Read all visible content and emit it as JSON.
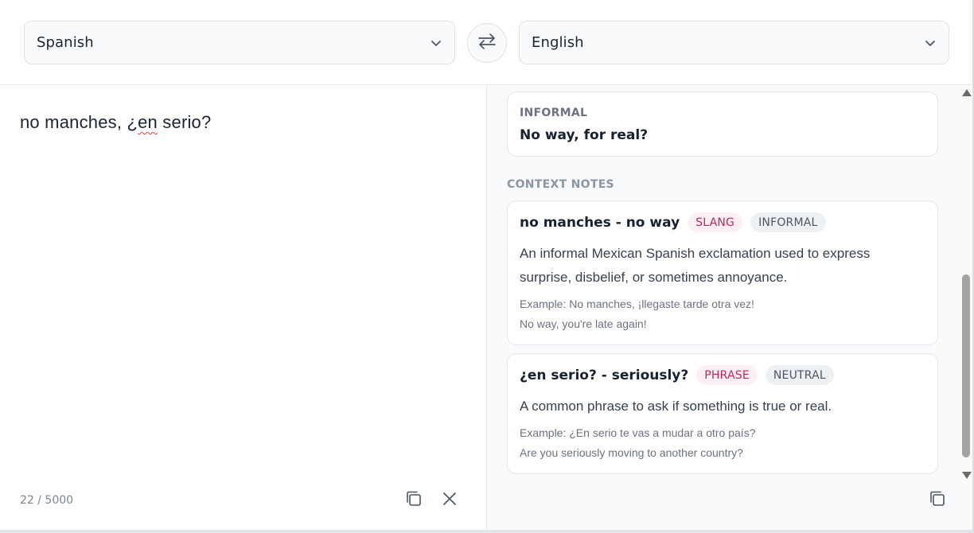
{
  "header": {
    "source_language": "Spanish",
    "target_language": "English"
  },
  "input": {
    "text_before": "no manches, ¿",
    "text_misspelled": "en",
    "text_after": " serio?",
    "char_count": "22 / 5000"
  },
  "output": {
    "informal_label": "INFORMAL",
    "informal_translation": "No way, for real?",
    "context_notes_title": "CONTEXT NOTES",
    "notes": [
      {
        "title": "no manches - no way",
        "tags": [
          "SLANG",
          "INFORMAL"
        ],
        "description": "An informal Mexican Spanish exclamation used to express surprise, disbelief, or sometimes annoyance.",
        "example_source": "Example: No manches, ¡llegaste tarde otra vez!",
        "example_target": "No way, you're late again!"
      },
      {
        "title": "¿en serio? - seriously?",
        "tags": [
          "PHRASE",
          "NEUTRAL"
        ],
        "description": "A common phrase to ask if something is true or real.",
        "example_source": "Example: ¿En serio te vas a mudar a otro país?",
        "example_target": "Are you seriously moving to another country?"
      }
    ]
  },
  "icons": {
    "dropdown": "chevron-down-icon",
    "swap": "swap-arrows-icon",
    "copy": "copy-icon",
    "clear": "close-icon"
  },
  "colors": {
    "accent_pink": "#c8245a",
    "tag_pink_bg": "#fdf0f4",
    "tag_gray_bg": "#eef1f4"
  }
}
